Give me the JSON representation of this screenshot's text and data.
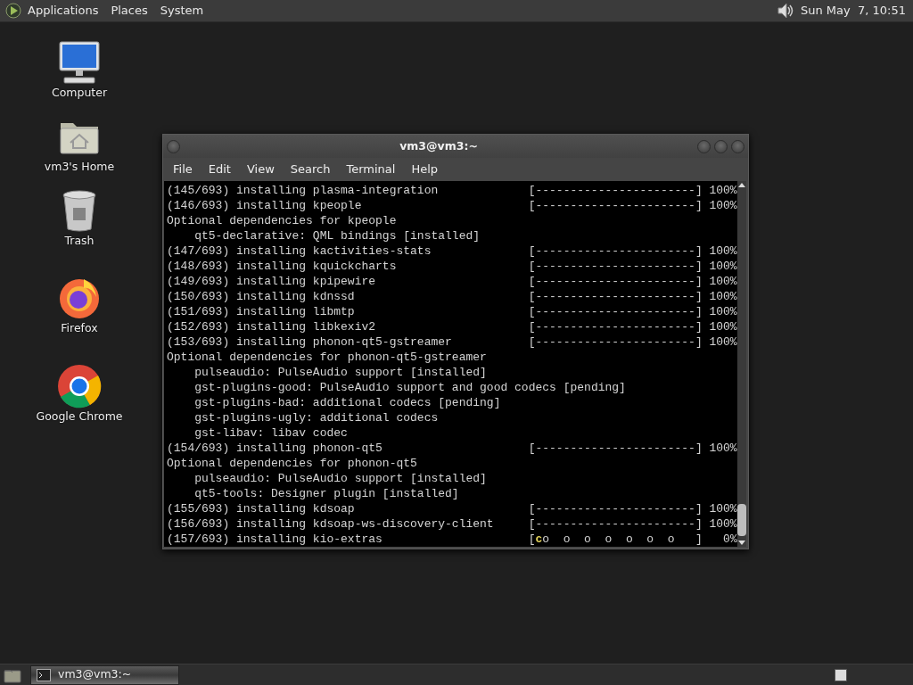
{
  "top_panel": {
    "menus": [
      "Applications",
      "Places",
      "System"
    ],
    "clock": "Sun May  7, 10:51"
  },
  "desktop_icons": [
    {
      "label": "Computer",
      "kind": "computer"
    },
    {
      "label": "vm3's Home",
      "kind": "home"
    },
    {
      "label": "Trash",
      "kind": "trash"
    },
    {
      "label": "Firefox",
      "kind": "firefox"
    },
    {
      "label": "Google Chrome",
      "kind": "chrome"
    }
  ],
  "terminal": {
    "title": "vm3@vm3:~",
    "menu": [
      "File",
      "Edit",
      "View",
      "Search",
      "Terminal",
      "Help"
    ],
    "lines": [
      {
        "kind": "progress",
        "text": "(145/693) installing plasma-integration",
        "bar": "[-----------------------]",
        "percent": "100%"
      },
      {
        "kind": "progress",
        "text": "(146/693) installing kpeople",
        "bar": "[-----------------------]",
        "percent": "100%"
      },
      {
        "kind": "plain",
        "text": "Optional dependencies for kpeople"
      },
      {
        "kind": "plain",
        "text": "    qt5-declarative: QML bindings [installed]"
      },
      {
        "kind": "progress",
        "text": "(147/693) installing kactivities-stats",
        "bar": "[-----------------------]",
        "percent": "100%"
      },
      {
        "kind": "progress",
        "text": "(148/693) installing kquickcharts",
        "bar": "[-----------------------]",
        "percent": "100%"
      },
      {
        "kind": "progress",
        "text": "(149/693) installing kpipewire",
        "bar": "[-----------------------]",
        "percent": "100%"
      },
      {
        "kind": "progress",
        "text": "(150/693) installing kdnssd",
        "bar": "[-----------------------]",
        "percent": "100%"
      },
      {
        "kind": "progress",
        "text": "(151/693) installing libmtp",
        "bar": "[-----------------------]",
        "percent": "100%"
      },
      {
        "kind": "progress",
        "text": "(152/693) installing libkexiv2",
        "bar": "[-----------------------]",
        "percent": "100%"
      },
      {
        "kind": "progress",
        "text": "(153/693) installing phonon-qt5-gstreamer",
        "bar": "[-----------------------]",
        "percent": "100%"
      },
      {
        "kind": "plain",
        "text": "Optional dependencies for phonon-qt5-gstreamer"
      },
      {
        "kind": "plain",
        "text": "    pulseaudio: PulseAudio support [installed]"
      },
      {
        "kind": "plain",
        "text": "    gst-plugins-good: PulseAudio support and good codecs [pending]"
      },
      {
        "kind": "plain",
        "text": "    gst-plugins-bad: additional codecs [pending]"
      },
      {
        "kind": "plain",
        "text": "    gst-plugins-ugly: additional codecs"
      },
      {
        "kind": "plain",
        "text": "    gst-libav: libav codec"
      },
      {
        "kind": "progress",
        "text": "(154/693) installing phonon-qt5",
        "bar": "[-----------------------]",
        "percent": "100%"
      },
      {
        "kind": "plain",
        "text": "Optional dependencies for phonon-qt5"
      },
      {
        "kind": "plain",
        "text": "    pulseaudio: PulseAudio support [installed]"
      },
      {
        "kind": "plain",
        "text": "    qt5-tools: Designer plugin [installed]"
      },
      {
        "kind": "progress",
        "text": "(155/693) installing kdsoap",
        "bar": "[-----------------------]",
        "percent": "100%"
      },
      {
        "kind": "progress",
        "text": "(156/693) installing kdsoap-ws-discovery-client",
        "bar": "[-----------------------]",
        "percent": "100%"
      },
      {
        "kind": "pacman",
        "text": "(157/693) installing kio-extras",
        "bar": "[co  o  o  o  o  o  o   ]",
        "percent": "0%"
      }
    ]
  },
  "taskbar": {
    "tasks": [
      {
        "label": "vm3@vm3:~",
        "selected": true
      }
    ]
  }
}
